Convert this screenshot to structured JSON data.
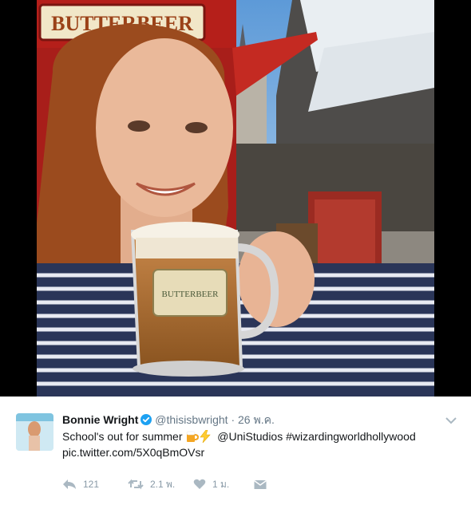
{
  "photo": {
    "sign_text": "BUTTERBEER",
    "mug_label": "BUTTERBEER"
  },
  "tweet": {
    "author_name": "Bonnie Wright",
    "handle": "@thisisbwright",
    "separator": "·",
    "timestamp": "26 พ.ค.",
    "text_prefix": "School's out for summer ",
    "mention": "@UniStudios",
    "hashtag": "#wizardingworldhollywood",
    "pic_link": "pic.twitter.com/5X0qBmOVsr"
  },
  "actions": {
    "reply_count": "121",
    "retweet_count": "2.1 พ.",
    "like_count": "1 ม."
  },
  "colors": {
    "secondary_text": "#657786",
    "action_gray": "#8899a6",
    "verified_blue": "#1da1f2"
  },
  "icons": [
    "reply-icon",
    "retweet-icon",
    "heart-icon",
    "envelope-icon",
    "verified-badge-icon",
    "chevron-down-icon",
    "beer-mug-emoji",
    "lightning-emoji"
  ]
}
